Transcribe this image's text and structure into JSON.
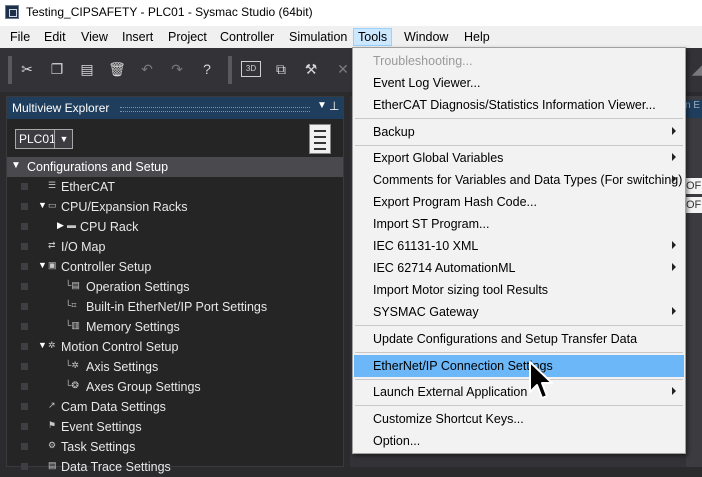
{
  "window": {
    "title": "Testing_CIPSAFETY - PLC01 - Sysmac Studio (64bit)"
  },
  "menubar": {
    "items": [
      "File",
      "Edit",
      "View",
      "Insert",
      "Project",
      "Controller",
      "Simulation",
      "Tools",
      "Window",
      "Help"
    ],
    "active": "Tools"
  },
  "toolbar": {
    "buttons": [
      "cut-icon",
      "copy-icon",
      "paste-icon",
      "delete-icon",
      "undo-icon",
      "redo-icon",
      "help-icon",
      "3d-view-icon",
      "window-icon",
      "wrench-icon"
    ],
    "label_3d": "3D"
  },
  "explorer": {
    "title": "Multiview Explorer",
    "device_select": "PLC01",
    "tree_root": "Configurations and Setup",
    "tree": [
      "EtherCAT",
      "CPU/Expansion Racks",
      "CPU Rack",
      "I/O Map",
      "Controller Setup",
      "Operation Settings",
      "Built-in EtherNet/IP Port Settings",
      "Memory Settings",
      "Motion Control Setup",
      "Axis Settings",
      "Axes Group Settings",
      "Cam Data Settings",
      "Event Settings",
      "Task Settings",
      "Data Trace Settings"
    ]
  },
  "background": {
    "cell_texts": [
      "OF",
      "OF"
    ],
    "tab_label": "n E"
  },
  "tools_menu": {
    "items": [
      {
        "label": "Troubleshooting...",
        "disabled": true
      },
      {
        "label": "Event Log Viewer..."
      },
      {
        "label": "EtherCAT Diagnosis/Statistics Information Viewer..."
      },
      {
        "label": "Backup",
        "submenu": true
      },
      {
        "label": "Export Global Variables",
        "submenu": true
      },
      {
        "label": "Comments for Variables and Data Types (For switching)",
        "submenu": true
      },
      {
        "label": "Export Program Hash Code..."
      },
      {
        "label": "Import ST Program..."
      },
      {
        "label": "IEC 61131-10 XML",
        "submenu": true
      },
      {
        "label": "IEC 62714 AutomationML",
        "submenu": true
      },
      {
        "label": "Import Motor sizing tool Results"
      },
      {
        "label": "SYSMAC Gateway",
        "submenu": true
      },
      {
        "label": "Update Configurations and Setup Transfer Data"
      },
      {
        "label": "EtherNet/IP Connection Settings",
        "highlighted": true
      },
      {
        "label": "Launch External Application",
        "submenu": true
      },
      {
        "label": "Customize Shortcut Keys..."
      },
      {
        "label": "Option..."
      }
    ]
  },
  "colors": {
    "menu_highlight": "#6bb7f7",
    "explorer_header": "#1f3d5c",
    "app_background": "#2b2b2e"
  }
}
